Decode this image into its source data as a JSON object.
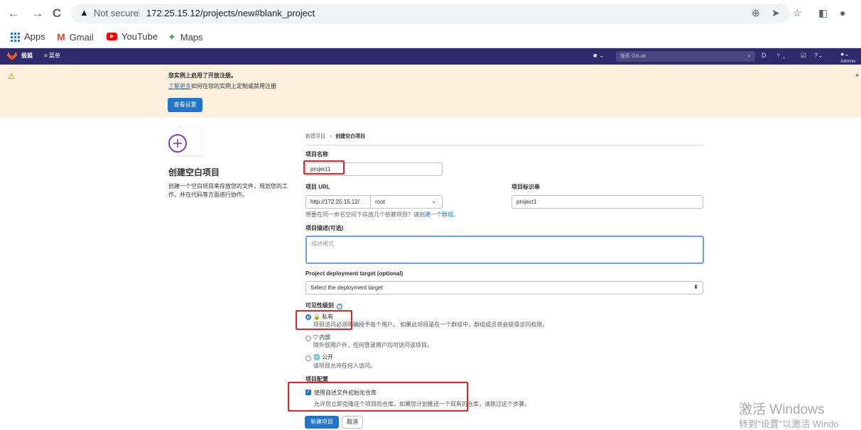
{
  "browser": {
    "back": "←",
    "forward": "→",
    "reload": "C",
    "security_warning": "▲",
    "security_label": "Not secure",
    "url": "172.25.15.12/projects/new#blank_project",
    "bookmarks": [
      {
        "label": "Apps",
        "icon": "apps-grid-icon",
        "color": "#1a73e8"
      },
      {
        "label": "Gmail",
        "icon": "gmail-icon",
        "color": "#ea4335"
      },
      {
        "label": "YouTube",
        "icon": "youtube-icon",
        "color": "#ff0000"
      },
      {
        "label": "Maps",
        "icon": "maps-icon",
        "color": "#34a853"
      }
    ]
  },
  "gitlab_nav": {
    "brand": "极狐",
    "menu": "≡ 菜单",
    "search_placeholder": "搜索 GitLab",
    "admin_label": "Adminis"
  },
  "banner": {
    "title": "您实例上启用了开放注册。",
    "link": "了解更多",
    "text": "如何在您的实例上定制或禁用注册",
    "button": "查看设置",
    "close": "×"
  },
  "left": {
    "title": "创建空白项目",
    "description": "创建一个空白项目来存放您的文件，规划您的工作，并在代码等方面进行协作。"
  },
  "form": {
    "breadcrumb_parent": "新建项目",
    "breadcrumb_sep": "›",
    "breadcrumb_current": "创建空白项目",
    "project_name_label": "项目名称",
    "project_name_value": "project1",
    "project_url_label": "项目 URL",
    "project_url_prefix": "http://172.25.15.12/",
    "namespace_value": "root",
    "project_slug_label": "项目标识串",
    "project_slug_value": "project1",
    "namespace_help": "想要在同一命名空间下存放几个依赖项目？请",
    "namespace_help_link": "创建一个群组。",
    "description_label": "项目描述(可选)",
    "description_placeholder": "描述格式",
    "deploy_target_label": "Project deployment target (optional)",
    "deploy_target_value": "Select the deployment target",
    "visibility_label": "可见性级别",
    "visibility_options": [
      {
        "title": "私有",
        "desc": "项目访问必须明确授予每个用户。 如果此项目是在一个群组中，群组成员将会获得访问权限。",
        "checked": true
      },
      {
        "title": "内部",
        "desc": "除外部用户外，任何登录用户均可访问该项目。",
        "checked": false
      },
      {
        "title": "公开",
        "desc": "该项目允许任何人访问。",
        "checked": false
      }
    ],
    "config_label": "项目配置",
    "init_readme_label": "使用自述文件初始化仓库",
    "init_readme_desc": "允许您立即克隆这个项目的仓库。如果您计划推送一个现有的仓库，请跳过这个步骤。",
    "create_button": "新建项目",
    "cancel_button": "取消"
  },
  "watermark": {
    "line1": "激活 Windows",
    "line2": "转到\"设置\"以激活 Windo"
  }
}
